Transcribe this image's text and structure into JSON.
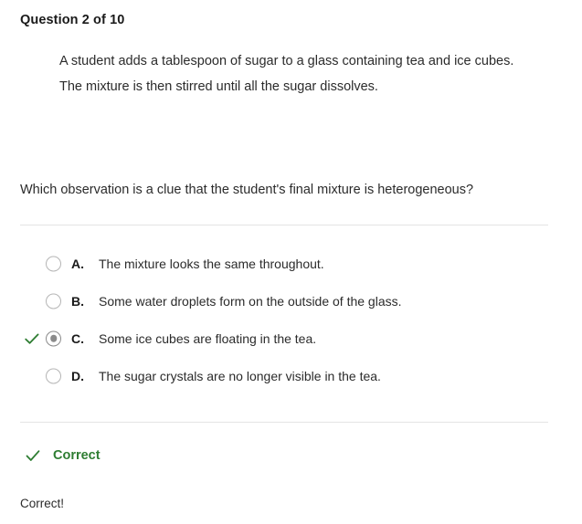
{
  "colors": {
    "green": "#2e7d32",
    "text": "#2b2b2b",
    "divider": "#e4e4e4",
    "radio_border": "#b5b5b5",
    "radio_selected": "#8b8b8b"
  },
  "header": {
    "title": "Question 2 of 10"
  },
  "stimulus": {
    "text": "A student adds a tablespoon of sugar to a glass containing tea and ice cubes. The mixture is then stirred until all the sugar dissolves."
  },
  "prompt": {
    "text": "Which observation is a clue that the student's final mixture is heterogeneous?"
  },
  "options": [
    {
      "letter": "A.",
      "text": "The mixture looks the same throughout.",
      "selected": false,
      "correct_mark": false
    },
    {
      "letter": "B.",
      "text": "Some water droplets form on the outside of the glass.",
      "selected": false,
      "correct_mark": false
    },
    {
      "letter": "C.",
      "text": "Some ice cubes are floating in the tea.",
      "selected": true,
      "correct_mark": true
    },
    {
      "letter": "D.",
      "text": "The sugar crystals are no longer visible in the tea.",
      "selected": false,
      "correct_mark": false
    }
  ],
  "result": {
    "status_label": "Correct",
    "feedback_text": "Correct!"
  }
}
